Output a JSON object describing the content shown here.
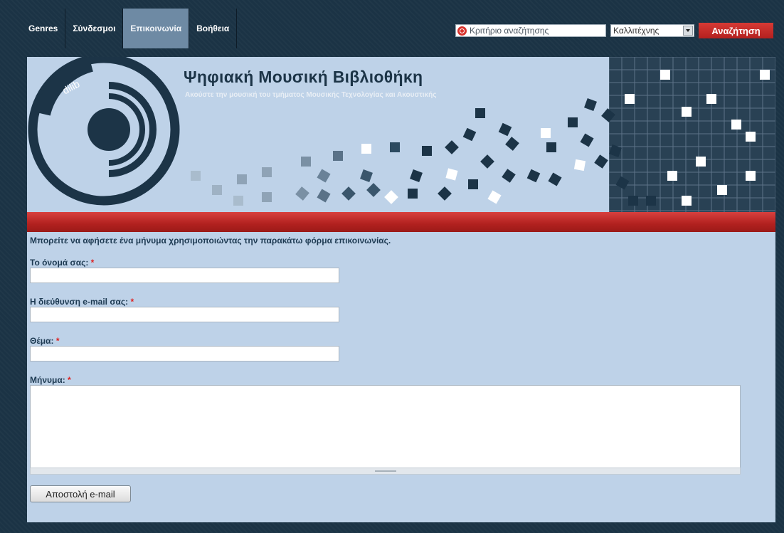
{
  "nav": {
    "items": [
      {
        "label": "Genres"
      },
      {
        "label": "Σύνδεσμοι"
      },
      {
        "label": "Επικοινωνία",
        "active": true
      },
      {
        "label": "Βοήθεια"
      }
    ]
  },
  "search": {
    "value": "Κριτήριο αναζήτησης",
    "select_value": "Καλλιτέχνης",
    "button_label": "Αναζήτηση"
  },
  "header": {
    "logo_text": "dilib",
    "title": "Ψηφιακή Μουσική Βιβλιοθήκη",
    "subtitle": "Ακούστε την μουσική του τμήματος Μουσικής Τεχνολογίας και Ακουστικής"
  },
  "form": {
    "intro": "Μπορείτε να αφήσετε ένα μήνυμα χρησιμοποιώντας την παρακάτω φόρμα επικοινωνίας.",
    "name_label": "Το όνομά σας:",
    "email_label": "Η διεύθυνση e-mail σας:",
    "subject_label": "Θέμα:",
    "message_label": "Μήνυμα:",
    "required_mark": "*",
    "submit_label": "Αποστολή e-mail"
  },
  "colors": {
    "accent_red": "#c52b28",
    "background": "#bed2e8",
    "frame": "#1b3345",
    "dark": "#1c3447"
  }
}
